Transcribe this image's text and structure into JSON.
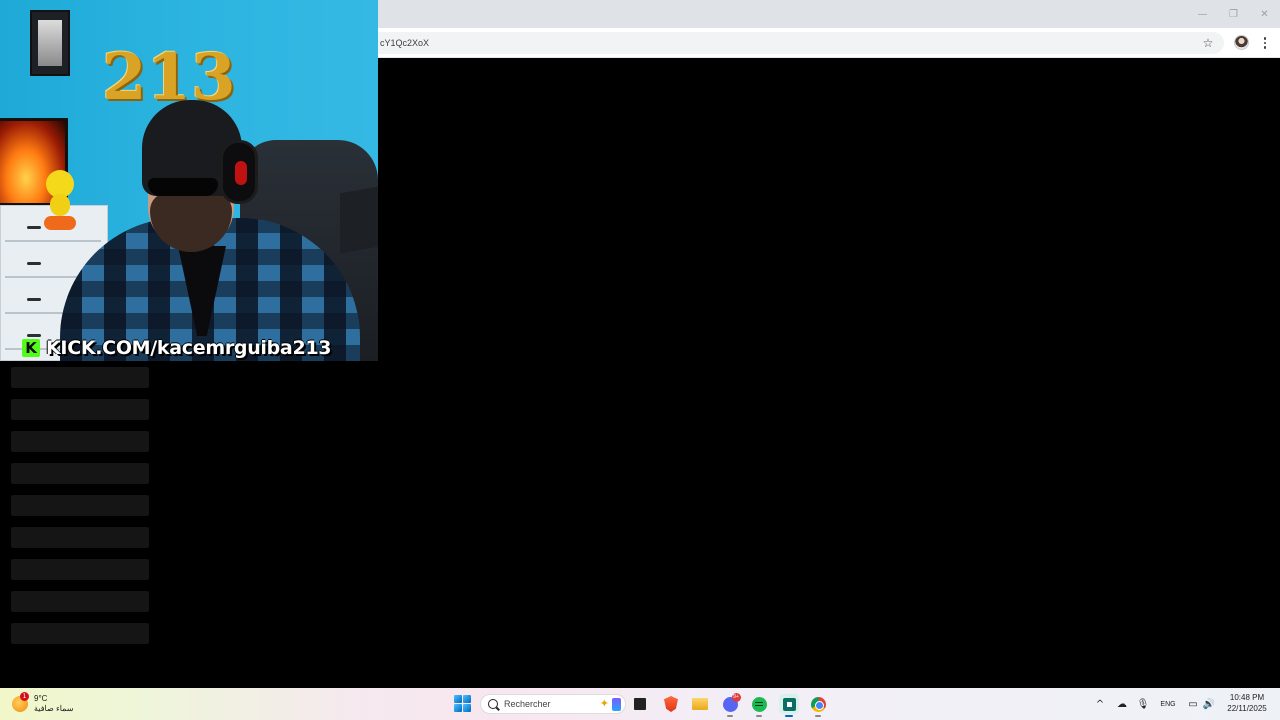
{
  "browser": {
    "url_fragment": "cY1Qc2XoX",
    "window_controls": {
      "minimize": "—",
      "maximize": "❐",
      "close": "✕"
    },
    "star_icon": "☆"
  },
  "stream_overlay": {
    "balloon_text": "213",
    "kick_logo_letter": "K",
    "kick_url": "KICK.COM/kacemrguiba213",
    "accent": "#53fc18"
  },
  "placeholder_rows": 9,
  "taskbar": {
    "weather": {
      "temp": "9°C",
      "condition": "سماء صافية",
      "badge": "1"
    },
    "search_placeholder": "Rechercher",
    "discord_badge": "9+",
    "tray": {
      "language": "ENG",
      "chevron": "^"
    },
    "clock": {
      "time": "10:48 PM",
      "date": "22/11/2025"
    }
  }
}
